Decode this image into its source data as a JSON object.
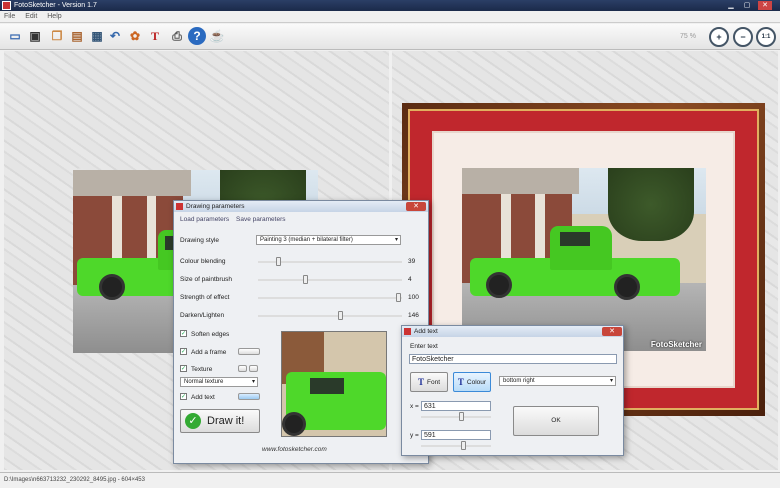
{
  "window": {
    "title": "FotoSketcher - Version 1.7"
  },
  "menu": [
    "File",
    "Edit",
    "Help"
  ],
  "toolbar": {
    "icons": [
      "folder-open-icon",
      "save-icon",
      "copy-icon",
      "paste-icon",
      "scan-icon",
      "undo-icon",
      "palette-icon",
      "text-icon",
      "print-icon",
      "help-icon",
      "coffee-icon"
    ],
    "zoom": "75 %",
    "zoom_buttons": [
      "+",
      "−",
      "1:1"
    ]
  },
  "status": {
    "path": "D:\\Images\\n663713232_230292_8495.jpg - 604×453"
  },
  "canvas": {
    "watermark": "FotoSketcher"
  },
  "drawing_dialog": {
    "title": "Drawing parameters",
    "load": "Load parameters",
    "save": "Save parameters",
    "style_label": "Drawing style",
    "style_value": "Painting 3 (median + bilateral filter)",
    "sliders": [
      {
        "label": "Colour blending",
        "value": "39",
        "pos": 0.12
      },
      {
        "label": "Size of paintbrush",
        "value": "4",
        "pos": 0.33
      },
      {
        "label": "Strength of effect",
        "value": "100",
        "pos": 0.98
      },
      {
        "label": "Darken/Lighten",
        "value": "146",
        "pos": 0.57
      }
    ],
    "soften": "Soften edges",
    "frame": "Add a frame",
    "texture": "Texture",
    "texture_value": "Normal texture",
    "addtext": "Add text",
    "draw": "Draw it!",
    "url": "www.fotosketcher.com"
  },
  "text_dialog": {
    "title": "Add text",
    "enter": "Enter text",
    "value": "FotoSketcher",
    "font": "Font",
    "colour": "Colour",
    "position": "bottom right",
    "x_label": "x =",
    "x_value": "631",
    "y_label": "y =",
    "y_value": "591",
    "ok": "OK"
  },
  "colors": {
    "accent": "#4ed82a",
    "frame_red": "#c0272d"
  }
}
